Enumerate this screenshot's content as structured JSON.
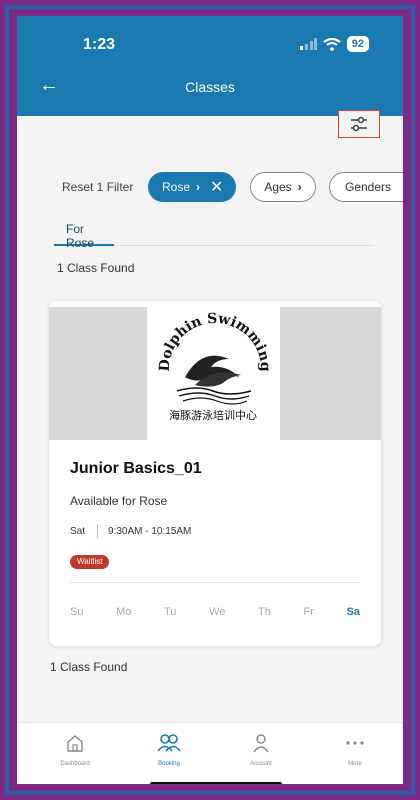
{
  "status_bar": {
    "time": "1:23",
    "battery": "92"
  },
  "header": {
    "title": "Classes"
  },
  "filters": {
    "reset_label": "Reset 1 Filter",
    "chips": [
      {
        "label": "Rose"
      },
      {
        "label": "Ages"
      },
      {
        "label": "Genders"
      }
    ]
  },
  "tab": {
    "label": "For Rose"
  },
  "results": {
    "count_text_top": "1 Class Found",
    "count_text_bottom": "1 Class Found"
  },
  "class_card": {
    "logo_text_en": "Dolphin Swimming",
    "logo_text_cn": "海豚游泳培训中心",
    "name": "Junior Basics_01",
    "availability": "Available for Rose",
    "day": "Sat",
    "time": "9:30AM - 10:15AM",
    "badge": "Waitlist",
    "days": [
      "Su",
      "Mo",
      "Tu",
      "We",
      "Th",
      "Fr",
      "Sa"
    ],
    "active_day": "Sa"
  },
  "bottom_nav": [
    {
      "label": "Dashboard",
      "icon": "home-icon"
    },
    {
      "label": "Booking",
      "icon": "people-icon"
    },
    {
      "label": "Account",
      "icon": "person-icon"
    },
    {
      "label": "More",
      "icon": "more-icon"
    }
  ],
  "colors": {
    "primary": "#1979b0",
    "waitlist": "#c0392b",
    "frame_purple": "#7b2a86",
    "frame_blue": "#2e5da8",
    "filter_border": "#d9423a"
  }
}
